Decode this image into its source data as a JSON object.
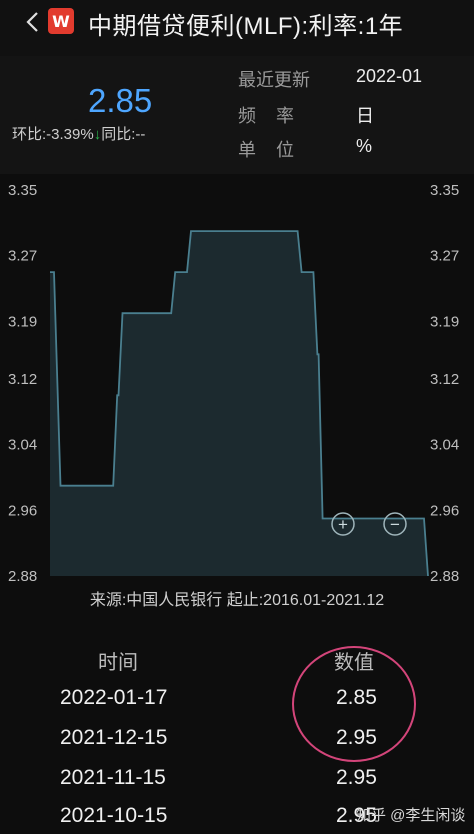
{
  "header": {
    "app_badge": "W",
    "title": "中期借贷便利(MLF):利率:1年"
  },
  "summary": {
    "value": "2.85",
    "hb_label": "环比:",
    "hb_value": "-3.39%",
    "hb_arrow": "↓",
    "tb_label": "同比:",
    "tb_value": "--",
    "meta": [
      {
        "label": "最近更新",
        "value": "2022-01"
      },
      {
        "label": "频    率",
        "value": "日"
      },
      {
        "label": "单    位",
        "value": "%"
      }
    ]
  },
  "chart_data": {
    "type": "area",
    "color": "#4a7f8f",
    "ylim": [
      2.88,
      3.35
    ],
    "yticks": [
      "3.35",
      "3.27",
      "3.19",
      "3.12",
      "3.04",
      "2.96",
      "2.88"
    ],
    "xlim": [
      "2016-01",
      "2021-12"
    ],
    "x": [
      "2016-01",
      "2016-01",
      "2016-03",
      "2016-03",
      "2017-01",
      "2017-01",
      "2017-02",
      "2017-02",
      "2017-03",
      "2017-03",
      "2017-12",
      "2017-12",
      "2018-03",
      "2018-03",
      "2019-12",
      "2019-12",
      "2020-03",
      "2020-03",
      "2020-04",
      "2020-04",
      "2021-12",
      "2021-12"
    ],
    "values": [
      3.25,
      3.25,
      2.99,
      2.99,
      2.99,
      3.1,
      3.1,
      3.2,
      3.2,
      3.2,
      3.2,
      3.25,
      3.25,
      3.3,
      3.3,
      3.25,
      3.25,
      3.15,
      3.15,
      2.95,
      2.95,
      2.88
    ],
    "controls": {
      "zoom_in": "+",
      "zoom_out": "−"
    }
  },
  "source_text": "来源:中国人民银行 起止:2016.01-2021.12",
  "table": {
    "headers": [
      "时间",
      "数值"
    ],
    "rows": [
      {
        "date": "2022-01-17",
        "value": "2.85"
      },
      {
        "date": "2021-12-15",
        "value": "2.95"
      },
      {
        "date": "2021-11-15",
        "value": "2.95"
      },
      {
        "date": "2021-10-15",
        "value": "2.95"
      }
    ]
  },
  "watermark": "知乎 @李生闲谈"
}
